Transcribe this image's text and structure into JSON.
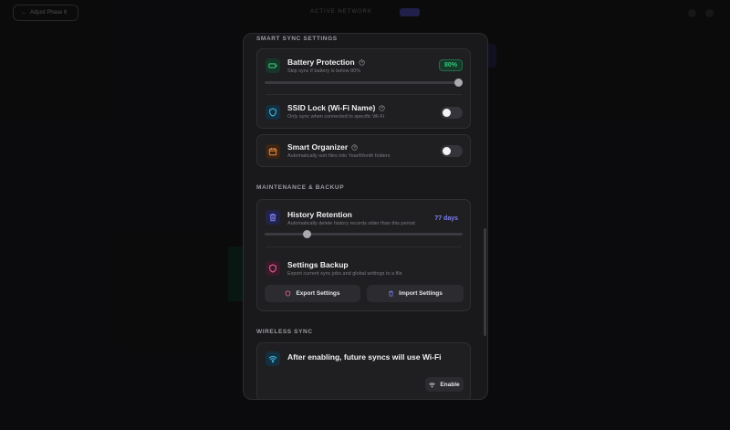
{
  "background": {
    "back_button_label": "Adjust Phase 6",
    "title": "ACTIVE NETWORK"
  },
  "sections": {
    "smart_sync": "SMART SYNC SETTINGS",
    "maintenance": "MAINTENANCE & BACKUP",
    "wireless": "WIRELESS SYNC"
  },
  "battery": {
    "title": "Battery Protection",
    "description": "Skip sync if battery is below 80%",
    "value_label": "80%",
    "value": 80
  },
  "ssid": {
    "title": "SSID Lock (Wi-Fi Name)",
    "description": "Only sync when connected to specific Wi-Fi",
    "enabled": false
  },
  "organizer": {
    "title": "Smart Organizer",
    "description": "Automatically sort files into Year/Month folders",
    "enabled": false
  },
  "history": {
    "title": "History Retention",
    "description": "Automatically delete history records older than this period",
    "value_label": "77 days",
    "fraction": 0.2
  },
  "backup": {
    "title": "Settings Backup",
    "description": "Export current sync jobs and global settings to a file",
    "export_label": "Export Settings",
    "import_label": "Import Settings"
  },
  "wireless": {
    "message": "After enabling, future syncs will use Wi-Fi",
    "enable_label": "Enable"
  },
  "colors": {
    "green": "#34c77b",
    "cyan": "#3fb5d6",
    "orange": "#f08a3c",
    "indigo": "#7b7ff0",
    "pink": "#e0608f"
  },
  "icons": {
    "battery": "battery-icon",
    "ssid": "shield-icon",
    "organizer": "calendar-icon",
    "history": "trash-icon",
    "backup": "shield-icon",
    "wireless": "wifi-icon"
  }
}
